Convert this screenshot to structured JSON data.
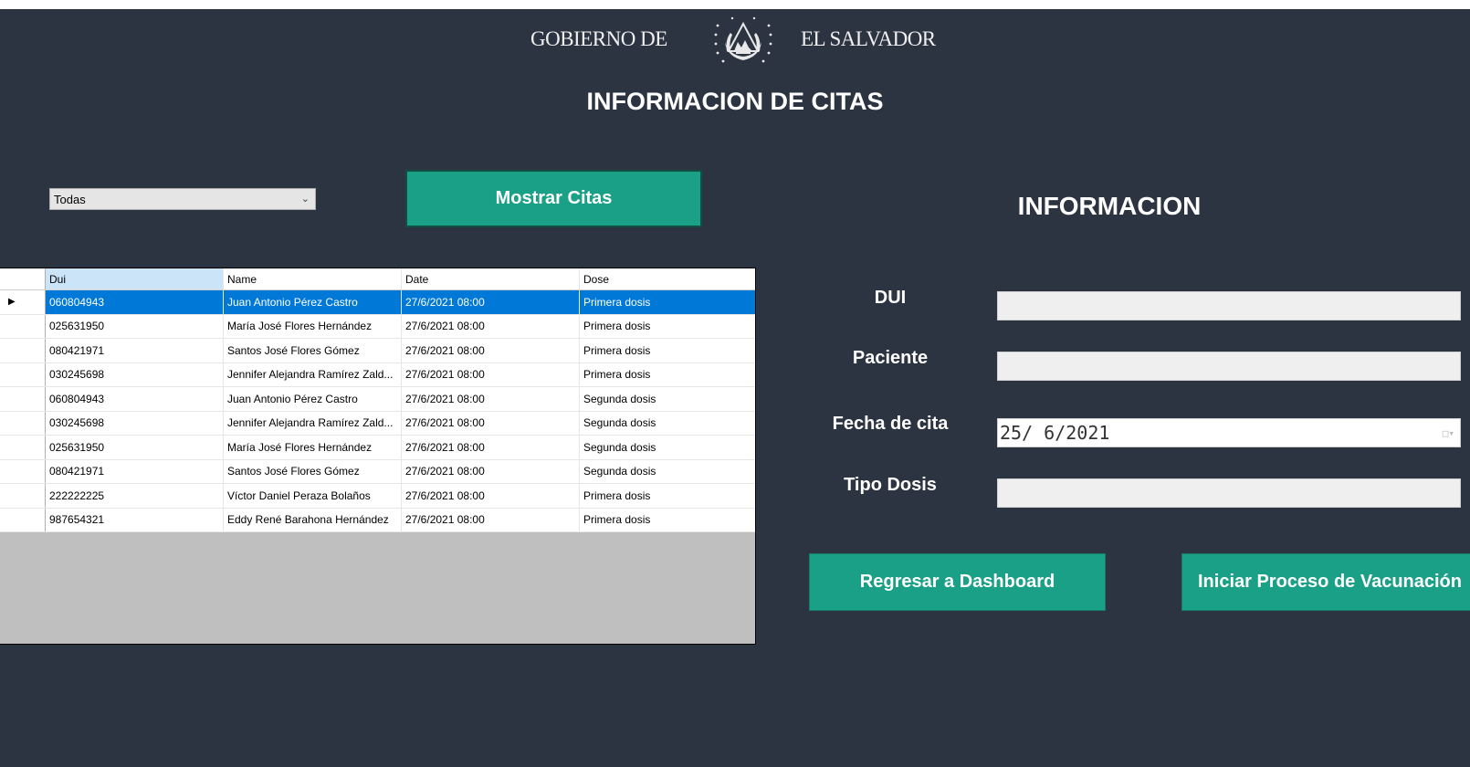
{
  "header": {
    "gobierno_left": "GOBIERNO DE",
    "gobierno_right": "EL SALVADOR",
    "emblem_icon": "el-salvador-coat-of-arms-icon",
    "title": "INFORMACION DE CITAS"
  },
  "filter": {
    "selected": "Todas"
  },
  "buttons": {
    "mostrar": "Mostrar Citas",
    "regresar": "Regresar a Dashboard",
    "iniciar": "Iniciar Proceso de Vacunación"
  },
  "grid": {
    "columns": [
      "Dui",
      "Name",
      "Date",
      "Dose"
    ],
    "rows": [
      {
        "dui": "060804943",
        "name": "Juan Antonio Pérez Castro",
        "date": "27/6/2021 08:00",
        "dose": "Primera dosis"
      },
      {
        "dui": "025631950",
        "name": "María José Flores Hernández",
        "date": "27/6/2021 08:00",
        "dose": "Primera dosis"
      },
      {
        "dui": "080421971",
        "name": "Santos José Flores Gómez",
        "date": "27/6/2021 08:00",
        "dose": "Primera dosis"
      },
      {
        "dui": "030245698",
        "name": "Jennifer Alejandra Ramírez Zald...",
        "date": "27/6/2021 08:00",
        "dose": "Primera dosis"
      },
      {
        "dui": "060804943",
        "name": "Juan Antonio Pérez Castro",
        "date": "27/6/2021 08:00",
        "dose": "Segunda dosis"
      },
      {
        "dui": "030245698",
        "name": "Jennifer Alejandra Ramírez Zald...",
        "date": "27/6/2021 08:00",
        "dose": "Segunda dosis"
      },
      {
        "dui": "025631950",
        "name": "María José Flores Hernández",
        "date": "27/6/2021 08:00",
        "dose": "Segunda dosis"
      },
      {
        "dui": "080421971",
        "name": "Santos José Flores Gómez",
        "date": "27/6/2021 08:00",
        "dose": "Segunda dosis"
      },
      {
        "dui": "222222225",
        "name": "Víctor Daniel Peraza Bolaños",
        "date": "27/6/2021 08:00",
        "dose": "Primera dosis"
      },
      {
        "dui": "987654321",
        "name": "Eddy René Barahona Hernández",
        "date": "27/6/2021 08:00",
        "dose": "Primera dosis"
      }
    ]
  },
  "info": {
    "title": "INFORMACION",
    "dui_label": "DUI",
    "dui_value": "",
    "paciente_label": "Paciente",
    "paciente_value": "",
    "fecha_label": "Fecha de cita",
    "fecha_value": "25/ 6/2021",
    "tipo_label": "Tipo Dosis",
    "tipo_value": ""
  },
  "colors": {
    "background": "#2d3441",
    "accent": "#1aa087",
    "selection": "#0078d7"
  }
}
